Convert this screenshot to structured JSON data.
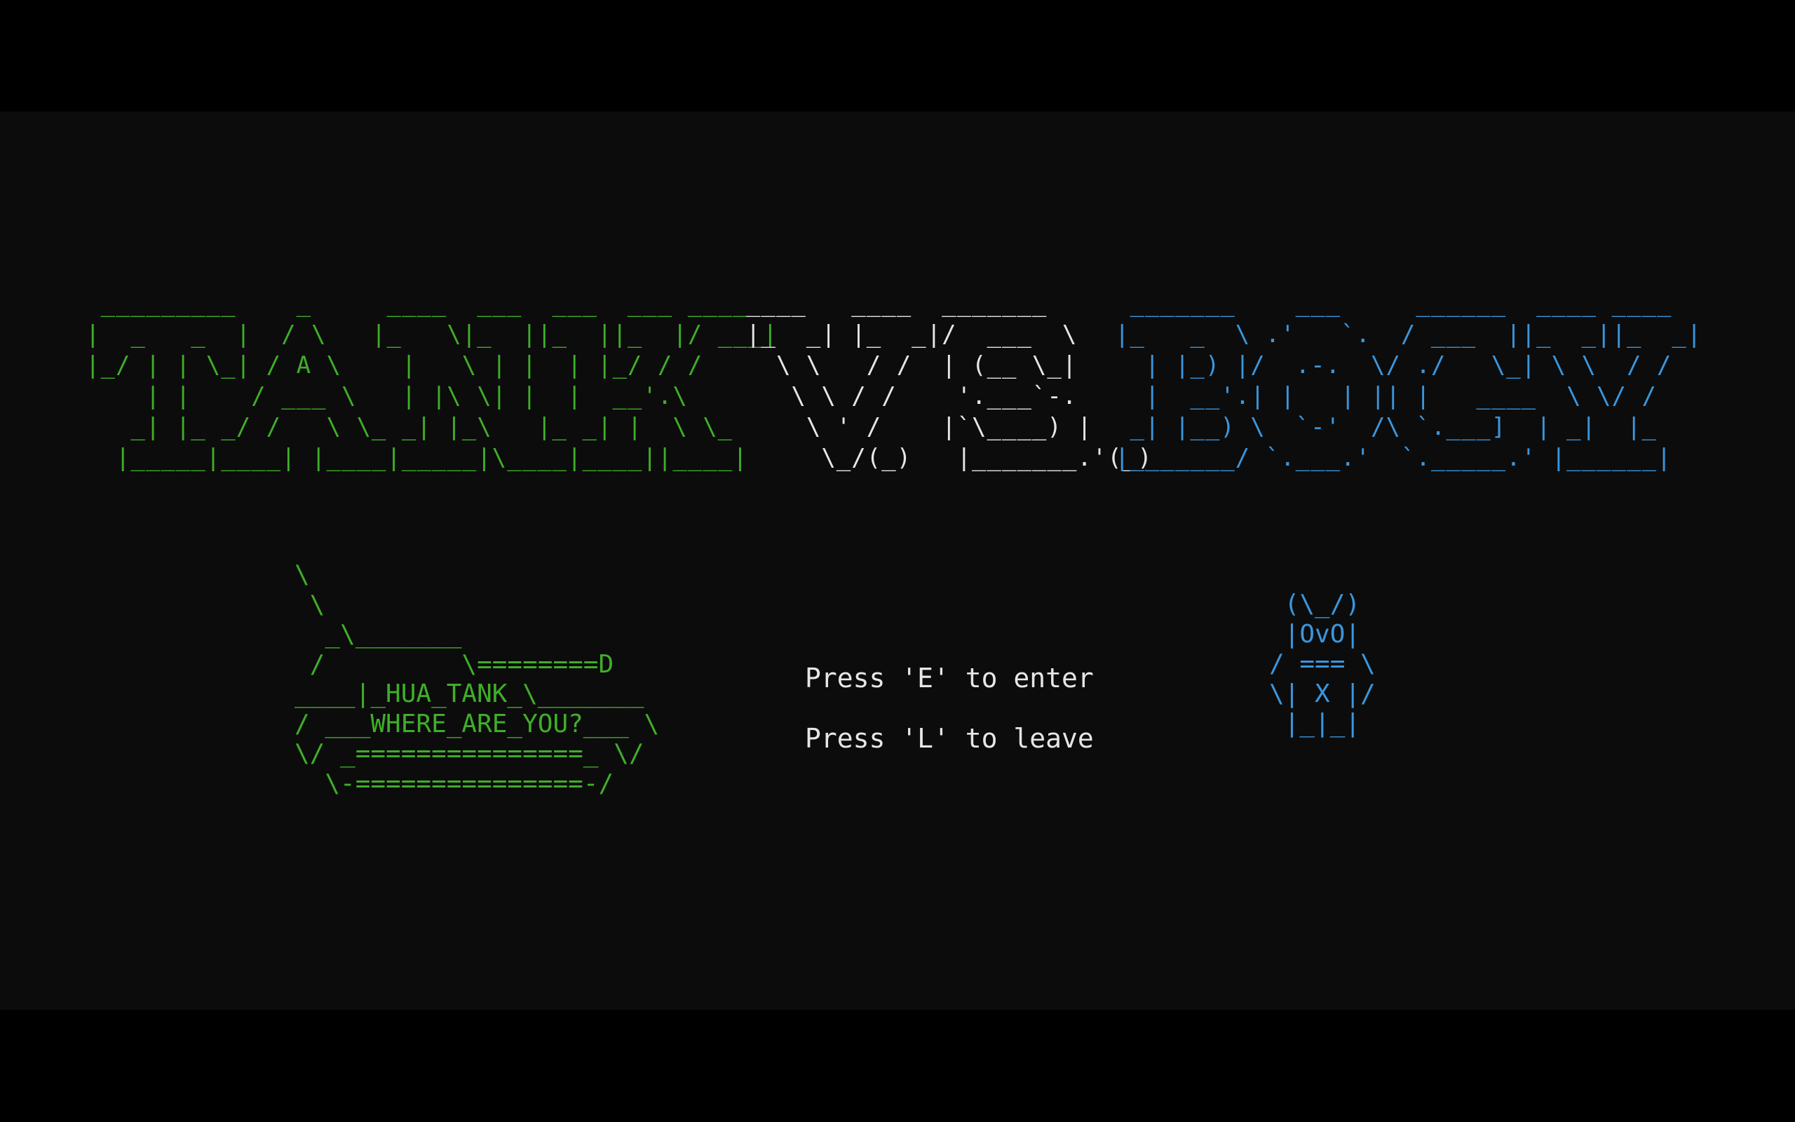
{
  "colors": {
    "background": "#0c0c0c",
    "outer": "#000000",
    "green": "#3fae29",
    "white": "#e6e6e6",
    "cyan": "#3a96dd"
  },
  "title": {
    "tank": [
      " _________    _     ____  ___  ___  ___ ____",
      "|  _   _  |  / \\   |_   \\|_  ||_  ||_  |/ ___|",
      "|_/ | | \\_| / A \\    |   \\ | |  | |_/ / /",
      "    | |    / ___ \\   | |\\ \\| |  |  __'.\\",
      "   _| |_ _/ /   \\ \\_ _| |_\\   |_ _| |  \\ \\_",
      "  |_____|____| |____|_____|\\____|____||____|"
    ],
    "vs": [
      "____   ____  _______",
      "|_  _| |_  _|/  ___  \\",
      "  \\ \\   / /  | (__ \\_|",
      "   \\ \\ / /    '.___`-.",
      "    \\ ' /    |`\\____) |",
      "     \\_/(_)   |_______.'(_)"
    ],
    "bogy": [
      " _______    ___     ______  ____ ____",
      "|_   _  \\ .'   `.  / ___  ||_  _||_  _|",
      "  | |_) |/  .-.  \\/ ./   \\_| \\ \\  / /",
      "  |  __'.| |   | || |   ____  \\ \\/ /",
      " _| |__) \\  `-'  /\\ `.___]  | _|  |_",
      "|_______/ `.___.'  `._____.' |______|"
    ]
  },
  "tank_art": [
    "\\",
    " \\",
    "  _\\_______",
    " /         \\========D",
    "____|_HUA_TANK_\\_______",
    "/ ___WHERE_ARE_YOU?___ \\",
    "\\/ _===============_ \\/",
    "  \\-===============-/"
  ],
  "bogy_art": [
    " (\\_/)",
    " |OvO|",
    "/ === \\",
    "\\| X |/",
    " |_|_|"
  ],
  "menu": {
    "enter": "Press 'E' to enter",
    "leave": "Press 'L' to leave"
  }
}
